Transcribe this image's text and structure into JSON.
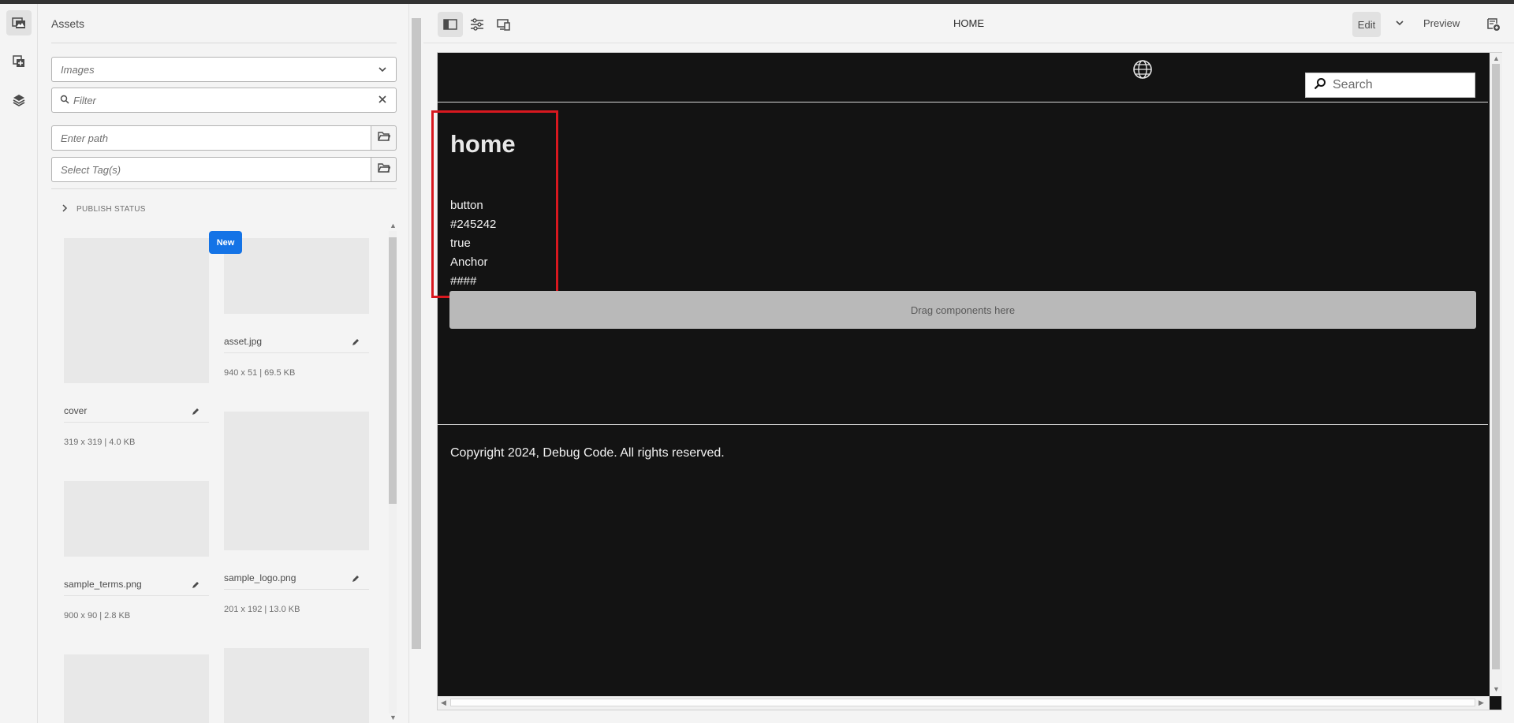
{
  "panel": {
    "title": "Assets",
    "type_select": "Images",
    "filter_placeholder": "Filter",
    "path_placeholder": "Enter path",
    "tags_placeholder": "Select Tag(s)",
    "publish_status": "PUBLISH STATUS",
    "new_badge": "New",
    "assets": [
      {
        "name": "cover",
        "meta": "319 x 319 | 4.0 KB"
      },
      {
        "name": "asset.jpg",
        "meta": "940 x 51 | 69.5 KB"
      },
      {
        "name": "sample_terms.png",
        "meta": "900 x 90 | 2.8 KB"
      },
      {
        "name": "sample_logo.png",
        "meta": "201 x 192 | 13.0 KB"
      }
    ]
  },
  "toolbar": {
    "page_title": "HOME",
    "edit_label": "Edit",
    "preview_label": "Preview"
  },
  "canvas": {
    "search_placeholder": "Search",
    "title": "home",
    "props": [
      "button",
      "#245242",
      "true",
      "Anchor",
      "####"
    ],
    "dropzone_label": "Drag components here",
    "copyright": "Copyright 2024, Debug Code. All rights reserved."
  },
  "colors": {
    "accent": "#1473e6",
    "highlight": "#d8181f",
    "canvas_bg": "#131313"
  },
  "icons": [
    "assets-icon",
    "components-icon",
    "layers-icon",
    "side-panel-icon",
    "page-properties-icon",
    "emulator-icon",
    "chevron-down-icon",
    "annotation-icon",
    "globe-icon",
    "search-icon",
    "folder-icon",
    "edit-icon",
    "close-icon",
    "chevron-right-icon"
  ]
}
